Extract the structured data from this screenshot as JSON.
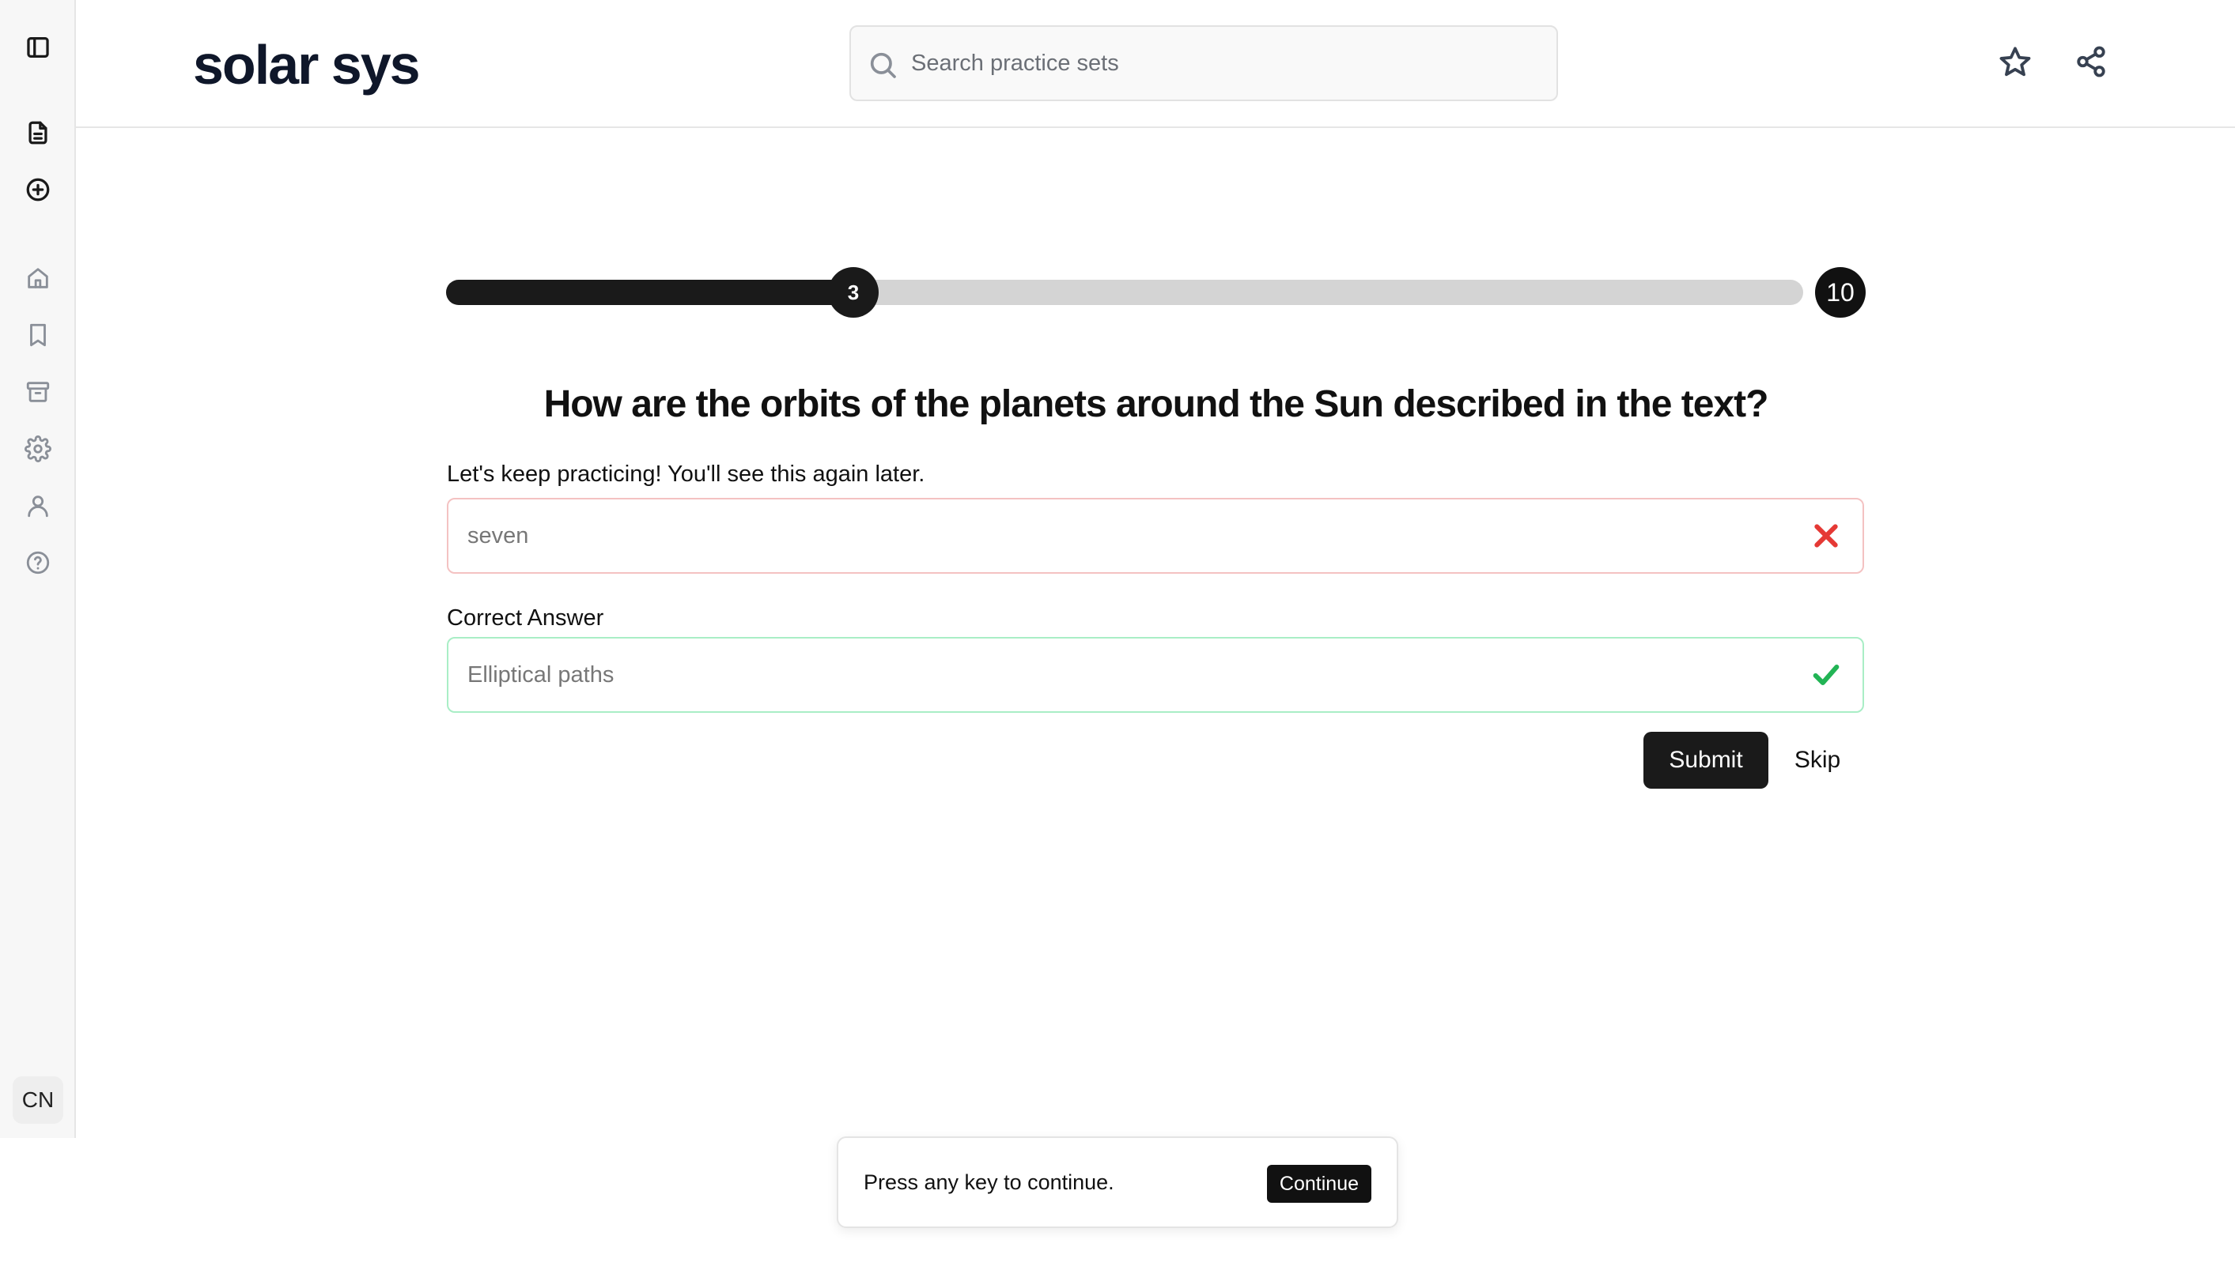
{
  "app": {
    "title": "solar sys"
  },
  "sidebar": {
    "items": [
      {
        "icon": "sidebar-toggle-icon",
        "interactable": true
      },
      {
        "icon": "document-icon",
        "interactable": true
      },
      {
        "icon": "plus-circle-icon",
        "interactable": true
      },
      {
        "icon": "home-icon",
        "interactable": true
      },
      {
        "icon": "bookmark-icon",
        "interactable": true
      },
      {
        "icon": "archive-icon",
        "interactable": true
      },
      {
        "icon": "gear-icon",
        "interactable": true
      },
      {
        "icon": "user-icon",
        "interactable": true
      },
      {
        "icon": "help-icon",
        "interactable": true
      }
    ],
    "language": "CN"
  },
  "header": {
    "search": {
      "placeholder": "Search practice sets",
      "value": ""
    },
    "actions": [
      {
        "icon": "star-icon"
      },
      {
        "icon": "share-icon"
      }
    ]
  },
  "progress": {
    "current": "3",
    "total": "10",
    "fraction": 0.3
  },
  "quiz": {
    "question": "How are the orbits of the planets around the Sun described in the text?",
    "feedback": "Let's keep practicing! You'll see this again later.",
    "user_answer": "seven",
    "correct_label": "Correct Answer",
    "correct_answer": "Elliptical paths",
    "submit_label": "Submit",
    "skip_label": "Skip"
  },
  "toast": {
    "message": "Press any key to continue.",
    "button": "Continue"
  },
  "colors": {
    "primary": "#1a1a1a",
    "wrong": "#e53935",
    "wrong_border": "#f4c2c2",
    "right": "#22b455",
    "right_border": "#a9eec6",
    "track": "#d4d4d4"
  }
}
